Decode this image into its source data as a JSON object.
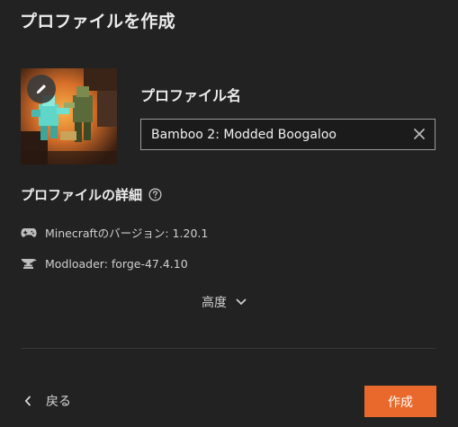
{
  "dialog": {
    "title": "プロファイルを作成"
  },
  "profile_name": {
    "label": "プロファイル名",
    "value": "Bamboo 2: Modded Boogaloo"
  },
  "details": {
    "title": "プロファイルの詳細",
    "minecraft_version": "Minecraftのバージョン: 1.20.1",
    "modloader": "Modloader: forge-47.4.10"
  },
  "advanced": {
    "label": "高度"
  },
  "footer": {
    "back_label": "戻る",
    "create_label": "作成"
  },
  "icons": {
    "edit": "pencil-icon",
    "clear": "close-icon",
    "help": "help-circle-icon",
    "version": "gamepad-icon",
    "modloader": "anvil-icon",
    "advanced": "chevron-down-icon",
    "back": "chevron-left-icon"
  },
  "colors": {
    "background": "#222222",
    "accent": "#e9692c",
    "input_border": "#9a9a9a"
  }
}
